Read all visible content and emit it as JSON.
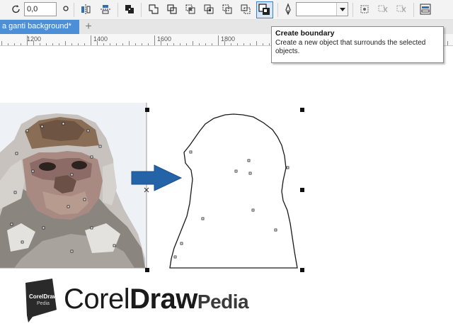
{
  "toolbar": {
    "rotation_value": "0,0",
    "outline_width_value": "",
    "icons": [
      "rotate-icon",
      "mirror-horizontal-icon",
      "mirror-vertical-icon",
      "combine-icon",
      "weld-icon",
      "trim-icon",
      "intersect-icon",
      "simplify-icon",
      "front-minus-back-icon",
      "back-minus-front-icon",
      "create-boundary-icon",
      "outline-pen-icon",
      "bring-to-front-icon",
      "break-apart-icon",
      "align-icon"
    ]
  },
  "tabs": {
    "document_tab_label": "a ganti background*",
    "add_tab_label": "+"
  },
  "ruler": {
    "labels": [
      "1200",
      "1400",
      "1600",
      "1800"
    ]
  },
  "tooltip": {
    "title": "Create boundary",
    "description": "Create a new object that surrounds the selected objects."
  },
  "brand": {
    "mark_line1": "CorelDraw",
    "mark_line2": "Pedia",
    "name_light": "Corel",
    "name_bold": "Draw",
    "name_suffix": "Pedia"
  },
  "colors": {
    "accent_blue": "#2e6fb8",
    "tab_active": "#4c8fd6",
    "arrow_blue": "#2563a9"
  }
}
